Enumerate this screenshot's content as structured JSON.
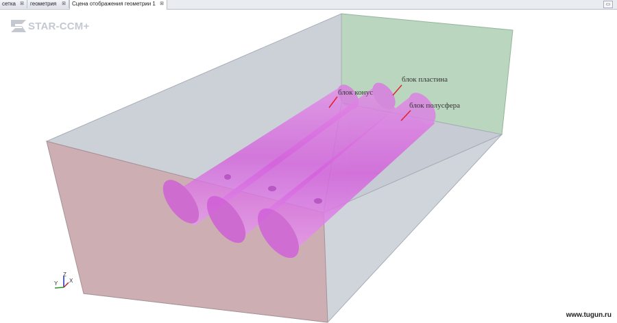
{
  "tabs": [
    {
      "label": "сетка",
      "close": "⊠"
    },
    {
      "label": "геометрия",
      "close": "⊠"
    },
    {
      "label": "Сцена отображения геометрии 1",
      "close": "⊠"
    }
  ],
  "logo": {
    "text": "STAR-CCM+"
  },
  "labels": {
    "cone": "блок конус",
    "plate": "блок пластина",
    "hemisphere": "блок полусфера"
  },
  "axes": {
    "x": "X",
    "y": "Y",
    "z": "Z"
  },
  "watermark": "www.tugun.ru",
  "colors": {
    "left_face": "#c9a8ac",
    "right_face": "#b8ceb9",
    "gray_face": "#c9ced6",
    "cylinder": "#d86ee0",
    "leader": "#e0202a"
  }
}
